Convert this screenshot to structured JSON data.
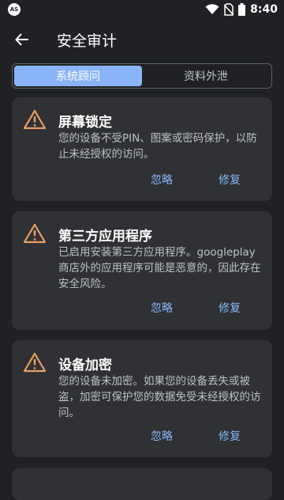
{
  "status_bar": {
    "badge": "AS",
    "time": "8:40"
  },
  "app_bar": {
    "title": "安全审计"
  },
  "tabs": [
    {
      "label": "系统顾问",
      "active": true
    },
    {
      "label": "资料外泄",
      "active": false
    }
  ],
  "cards": [
    {
      "title": "屏幕锁定",
      "body": "您的设备不受PIN、图案或密码保护，以防止未经授权的访问。",
      "ignore_label": "忽略",
      "fix_label": "修复"
    },
    {
      "title": "第三方应用程序",
      "body": "已启用安装第三方应用程序。googleplay商店外的应用程序可能是恶意的，因此存在安全风险。",
      "ignore_label": "忽略",
      "fix_label": "修复"
    },
    {
      "title": "设备加密",
      "body": "您的设备未加密。如果您的设备丢失或被盗，加密可保护您的数据免受未经授权的访问。",
      "ignore_label": "忽略",
      "fix_label": "修复"
    }
  ],
  "colors": {
    "background": "#202124",
    "card": "#303134",
    "accent": "#8ab4f8",
    "warning": "#e8a061"
  }
}
